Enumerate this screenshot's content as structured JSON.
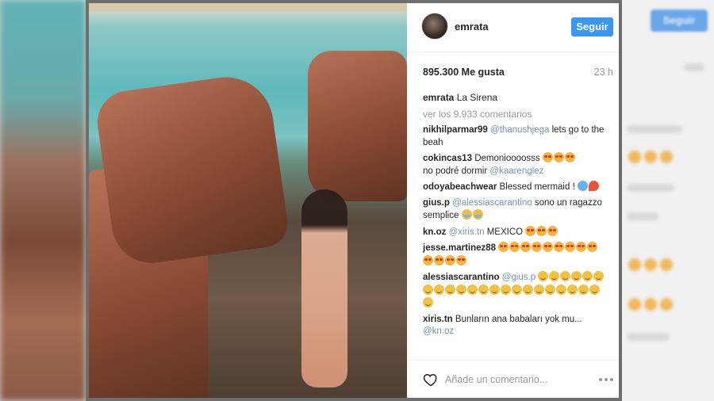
{
  "post": {
    "username": "emrata",
    "follow_label": "Seguir",
    "likes": "895.300 Me gusta",
    "time": "23 h",
    "caption_user": "emrata",
    "caption_text": "La Sirena",
    "view_all": "ver los 9.933 comentarios",
    "comment_placeholder": "Añade un comentario..."
  },
  "comments": [
    {
      "user": "nikhilparmar99",
      "mention": "@thanushjega",
      "text": "lets go to the beah",
      "emojis": []
    },
    {
      "user": "cokincas13",
      "text": "Demonioooosss",
      "emojis": [
        "heart-eyes",
        "heart-eyes",
        "heart-eyes"
      ],
      "text2": "no podré dormir",
      "mention": "@kaarenglez"
    },
    {
      "user": "odoyabeachwear",
      "text": "Blessed mermaid !",
      "emojis": [
        "wave",
        "flame"
      ]
    },
    {
      "user": "gius.p",
      "mention": "@alessiascarantino",
      "text": "sono un ragazzo semplice",
      "emojis": [
        "laugh",
        "laugh"
      ]
    },
    {
      "user": "kn.oz",
      "mention": "@xiris.tn",
      "text": "MEXICO",
      "emojis": [
        "heart-eyes",
        "heart-eyes",
        "heart-eyes"
      ]
    },
    {
      "user": "jesse.martinez88",
      "text": "",
      "emojis": [
        "heart-eyes",
        "heart-eyes",
        "heart-eyes",
        "heart-eyes",
        "heart-eyes",
        "heart-eyes",
        "heart-eyes",
        "heart-eyes",
        "heart-eyes",
        "heart-eyes",
        "heart-eyes",
        "heart-eyes",
        "heart-eyes"
      ]
    },
    {
      "user": "alessiascarantino",
      "mention": "@gius.p",
      "text": "",
      "emojis": [
        "smile",
        "smile",
        "smile",
        "smile",
        "smile",
        "smile",
        "smile",
        "smile",
        "smile",
        "smile",
        "smile",
        "smile",
        "smile",
        "smile",
        "smile",
        "smile",
        "smile",
        "smile",
        "smile",
        "smile",
        "smile",
        "smile",
        "smile"
      ]
    },
    {
      "user": "xiris.tn",
      "text": "Bunların ana babaları yok mu...",
      "mention": "@kn.oz",
      "emojis": []
    }
  ],
  "background": {
    "ghost_follow_label": "Seguir",
    "ghost_time": "23 h"
  },
  "colors": {
    "accent": "#3897f0",
    "modal_frame": "#6e6e6e"
  },
  "icons": {
    "like": "heart-outline-icon",
    "more": "more-dots-icon"
  }
}
